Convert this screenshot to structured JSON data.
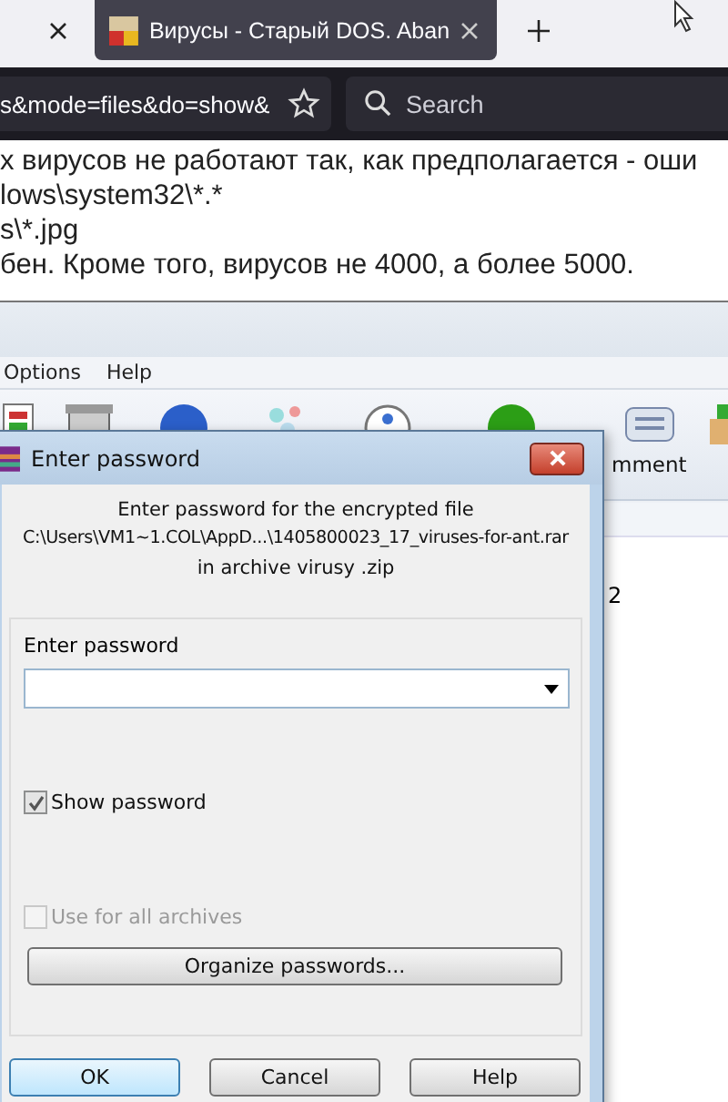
{
  "browser": {
    "tabs": [
      {
        "title": "Вирусы - Старый DOS. Aban",
        "selected": true
      }
    ],
    "address": "s&mode=files&do=show&",
    "search": {
      "placeholder": "Search"
    }
  },
  "page_lines": [
    "х вирусов не работают так, как предполагается - оши",
    "lows\\system32\\*.*",
    "s\\*.jpg",
    "бен. Кроме того, вирусов не 4000, а более 5000."
  ],
  "archiver": {
    "menu": [
      "Options",
      "Help"
    ],
    "toolbar_labels": [
      "mment"
    ],
    "list_cell": "2"
  },
  "dialog": {
    "title": "Enter password",
    "message": [
      "Enter password for the encrypted file",
      "C:\\Users\\VM1~1.COL\\AppD...\\1405800023_17_viruses-for-ant.rar",
      "in archive virusy .zip"
    ],
    "field_label": "Enter password",
    "options": [
      {
        "label": "Show password",
        "checked": true,
        "disabled": false
      },
      {
        "label": "Use for all archives",
        "checked": false,
        "disabled": true
      }
    ],
    "organize_button": "Organize passwords...",
    "buttons": [
      {
        "label": "OK",
        "default": true
      },
      {
        "label": "Cancel",
        "default": false
      },
      {
        "label": "Help",
        "default": false
      }
    ]
  }
}
